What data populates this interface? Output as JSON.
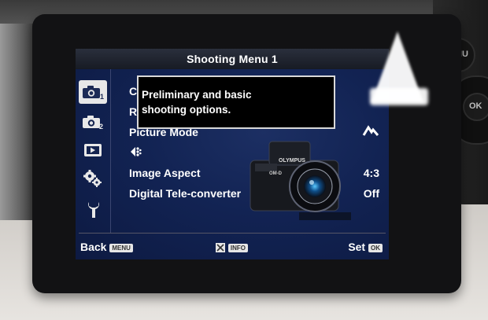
{
  "camera": {
    "side_buttons": [
      {
        "label": "NU"
      },
      {
        "label": "OK"
      }
    ]
  },
  "menu": {
    "title": "Shooting Menu 1",
    "tabs": [
      {
        "name": "shooting-menu-1",
        "icon": "camera-1-icon",
        "selected": true
      },
      {
        "name": "shooting-menu-2",
        "icon": "camera-2-icon",
        "selected": false
      },
      {
        "name": "playback-menu",
        "icon": "playback-icon",
        "selected": false
      },
      {
        "name": "custom-menu",
        "icon": "gears-icon",
        "selected": false
      },
      {
        "name": "setup-menu",
        "icon": "wrench-icon",
        "selected": false
      }
    ],
    "items": [
      {
        "label": "C",
        "value": ""
      },
      {
        "label": "R",
        "value": ""
      },
      {
        "label": "Picture Mode",
        "value": ""
      },
      {
        "label": "",
        "value": ""
      },
      {
        "label": "Image Aspect",
        "value": "4:3"
      },
      {
        "label": "Digital Tele-converter",
        "value": "Off"
      }
    ],
    "tooltip": {
      "line1": "Preliminary and basic",
      "line2": "shooting options."
    },
    "product_image": {
      "brand": "OLYMPUS",
      "model": "OM-D"
    },
    "footer": {
      "back_label": "Back",
      "back_button": "MENU",
      "info_button": "INFO",
      "set_label": "Set",
      "set_button": "OK"
    }
  }
}
